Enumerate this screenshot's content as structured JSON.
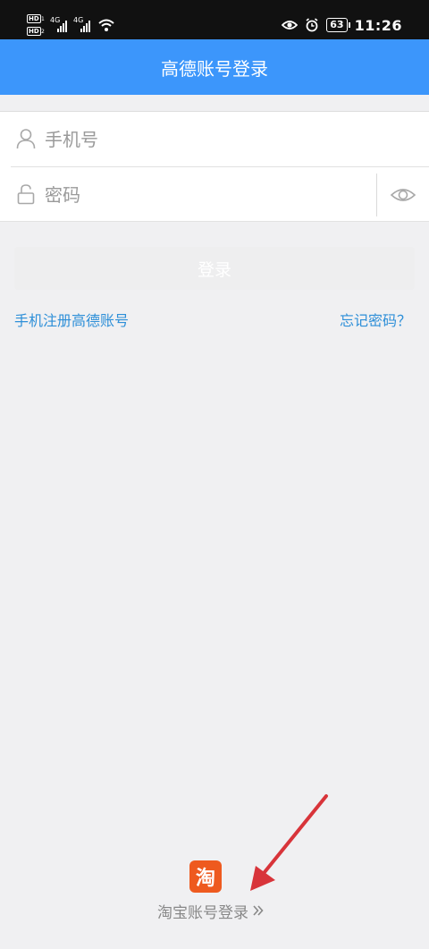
{
  "status_bar": {
    "hd_1": "HD",
    "hd_2": "HD",
    "sim_1": "1",
    "sim_2": "2",
    "net_1": "4G",
    "net_2": "4G",
    "battery": "63",
    "time": "11:26"
  },
  "header": {
    "title": "高德账号登录"
  },
  "form": {
    "phone_placeholder": "手机号",
    "phone_value": "",
    "password_placeholder": "密码",
    "password_value": ""
  },
  "buttons": {
    "login_label": "登录"
  },
  "links": {
    "register": "手机注册高德账号",
    "forgot": "忘记密码？"
  },
  "taobao": {
    "logo_char": "淘",
    "label": "淘宝账号登录"
  },
  "colors": {
    "header_bg": "#3c96fb",
    "link": "#2e8fd8",
    "taobao": "#ee5a1f",
    "annotation_arrow": "#d8343a"
  },
  "icons": {
    "phone_field": "user-icon",
    "password_field": "lock-icon",
    "show_password": "eye-icon",
    "taobao_more": "double-chevron-right-icon"
  }
}
